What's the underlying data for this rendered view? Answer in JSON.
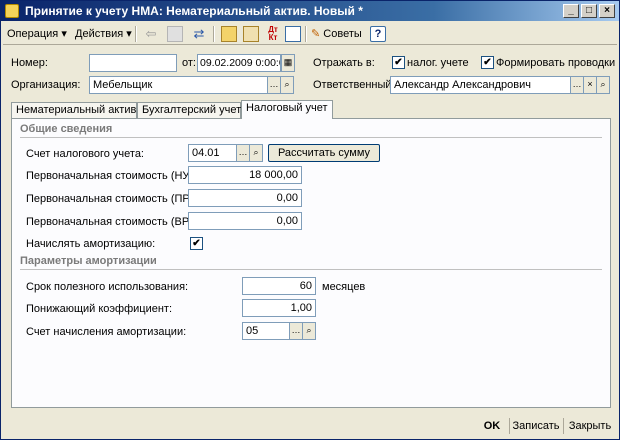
{
  "window": {
    "title": "Принятие к учету НМА: Нематериальный актив. Новый *",
    "controls": [
      "_",
      "□",
      "×"
    ]
  },
  "toolbar": {
    "operation_label": "Операция",
    "actions_label": "Действия",
    "dt_kt_label": "Дт\nКт",
    "tips_label": "Советы",
    "help_label": "?"
  },
  "header": {
    "number_label": "Номер:",
    "number_value": "",
    "from_label": "от:",
    "date_value": "09.02.2009  0:00:00",
    "reflect_label": "Отражать в:",
    "tax_check_label": "налог. учете",
    "tax_checked": true,
    "postings_label": "Формировать проводки",
    "postings_checked": true,
    "org_label": "Организация:",
    "org_value": "Мебельщик",
    "resp_label": "Ответственный:",
    "resp_value": "Александр Александрович"
  },
  "tabs": [
    {
      "label": "Нематериальный актив",
      "active": false
    },
    {
      "label": "Бухгалтерский учет",
      "active": false
    },
    {
      "label": "Налоговый учет",
      "active": true
    }
  ],
  "general": {
    "section_title": "Общие сведения",
    "tax_account_label": "Счет налогового учета:",
    "tax_account_value": "04.01",
    "calc_button": "Рассчитать сумму",
    "cost_nu_label": "Первоначальная стоимость (НУ):",
    "cost_nu_value": "18 000,00",
    "cost_pr_label": "Первоначальная стоимость (ПР):",
    "cost_pr_value": "0,00",
    "cost_vr_label": "Первоначальная стоимость (ВР):",
    "cost_vr_value": "0,00",
    "amort_label": "Начислять амортизацию:",
    "amort_checked": true
  },
  "amortization": {
    "section_title": "Параметры амортизации",
    "life_label": "Срок полезного использования:",
    "life_value": "60",
    "life_unit": "месяцев",
    "coef_label": "Понижающий коэффициент:",
    "coef_value": "1,00",
    "account_label": "Счет начисления амортизации:",
    "account_value": "05"
  },
  "footer": {
    "ok_label": "OK",
    "save_label": "Записать",
    "close_label": "Закрыть"
  }
}
